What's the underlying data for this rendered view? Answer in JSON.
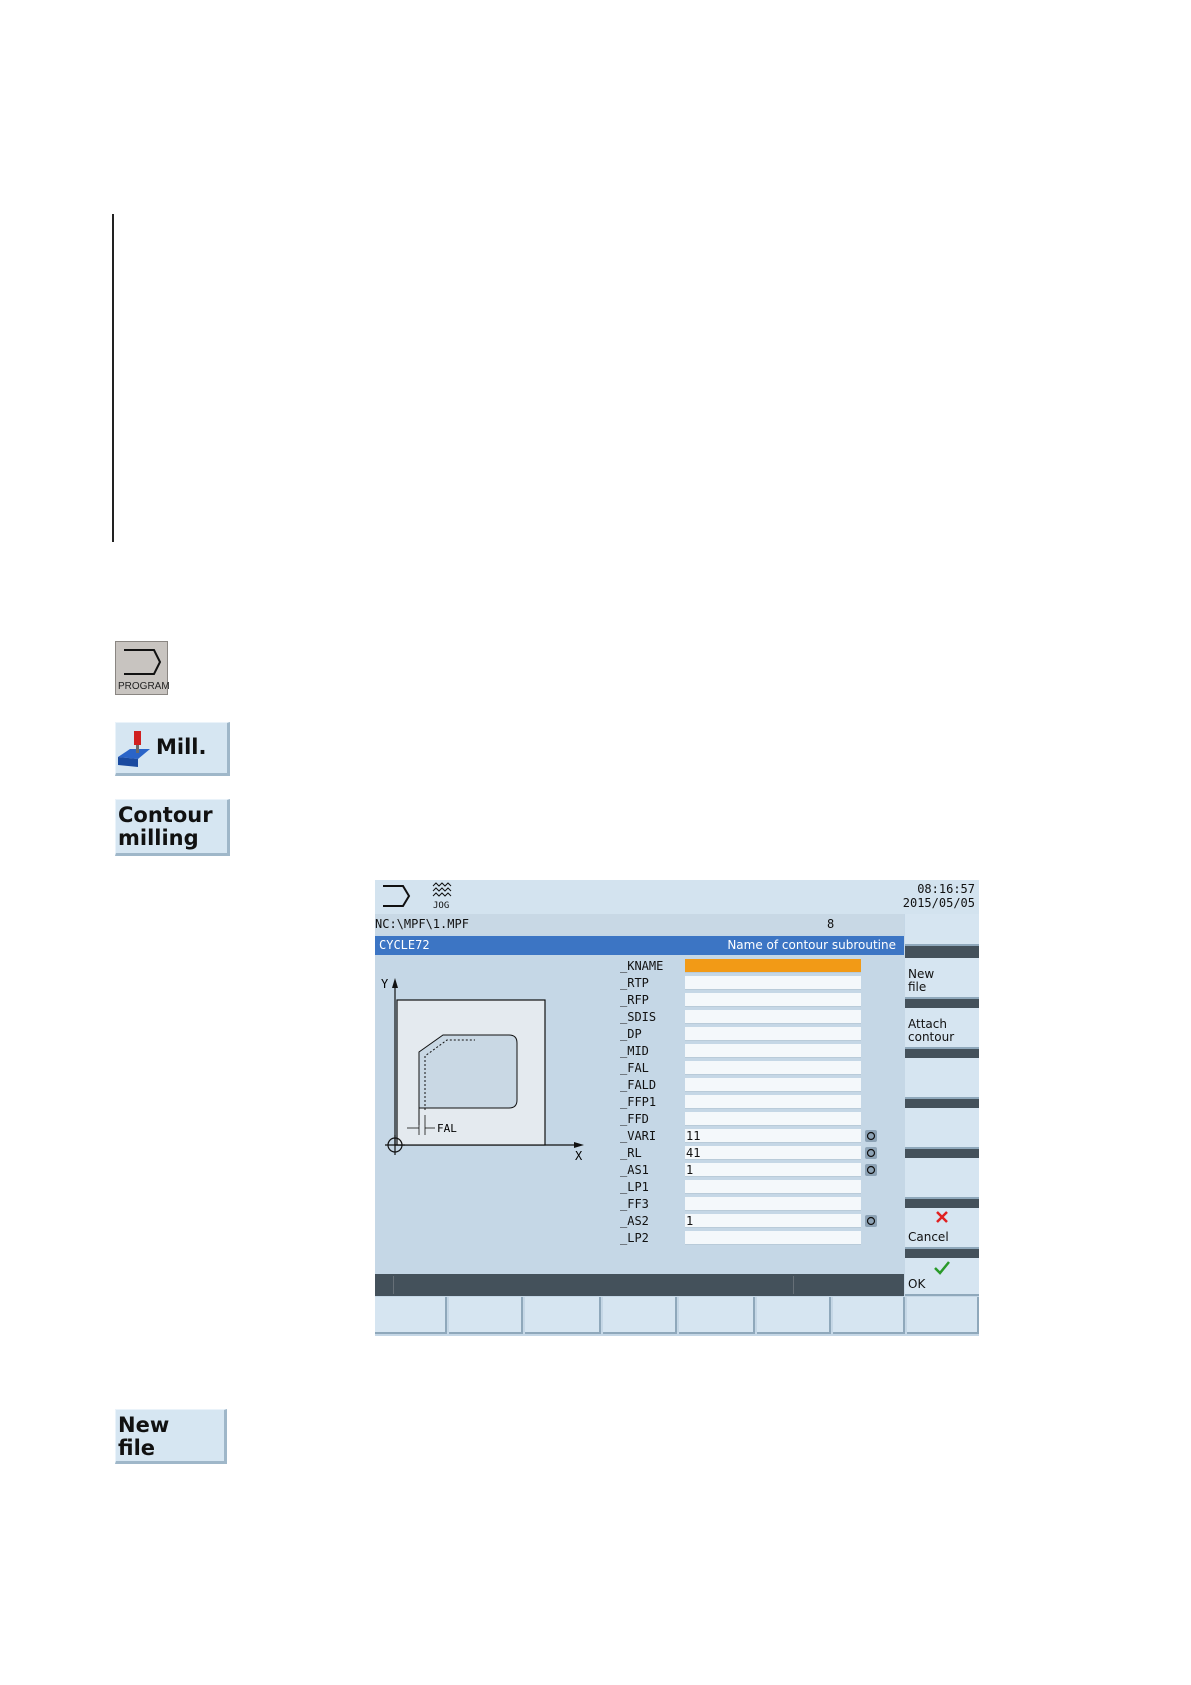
{
  "left_keys": {
    "program": "PROGRAM",
    "mill": "Mill.",
    "contour": "Contour\nmilling",
    "new_file": "New\nfile"
  },
  "screen": {
    "jog": "JOG",
    "time": "08:16:57",
    "date": "2015/05/05",
    "path": "NC:\\MPF\\1.MPF",
    "channel": "8",
    "cycle": "CYCLE72",
    "description": "Name of contour subroutine",
    "drawing_labels": {
      "y": "Y",
      "x": "X",
      "fal": "FAL"
    },
    "params": [
      {
        "name": "_KNAME",
        "value": ""
      },
      {
        "name": "_RTP",
        "value": ""
      },
      {
        "name": "_RFP",
        "value": ""
      },
      {
        "name": "_SDIS",
        "value": ""
      },
      {
        "name": "_DP",
        "value": ""
      },
      {
        "name": "_MID",
        "value": ""
      },
      {
        "name": "_FAL",
        "value": ""
      },
      {
        "name": "_FALD",
        "value": ""
      },
      {
        "name": "_FFP1",
        "value": ""
      },
      {
        "name": "_FFD",
        "value": ""
      },
      {
        "name": "_VARI",
        "value": "11"
      },
      {
        "name": "_RL",
        "value": "41"
      },
      {
        "name": "_AS1",
        "value": "1"
      },
      {
        "name": "_LP1",
        "value": ""
      },
      {
        "name": "_FF3",
        "value": ""
      },
      {
        "name": "_AS2",
        "value": "1"
      },
      {
        "name": "_LP2",
        "value": ""
      }
    ],
    "vsoft": {
      "new_file": "New\nfile",
      "attach_contour": "Attach\ncontour",
      "cancel": "Cancel",
      "ok": "OK"
    },
    "colors": {
      "active_field": "#f29a16",
      "title_bar": "#3c75c4",
      "cancel": "#e02020",
      "ok": "#2a9a2a"
    }
  }
}
